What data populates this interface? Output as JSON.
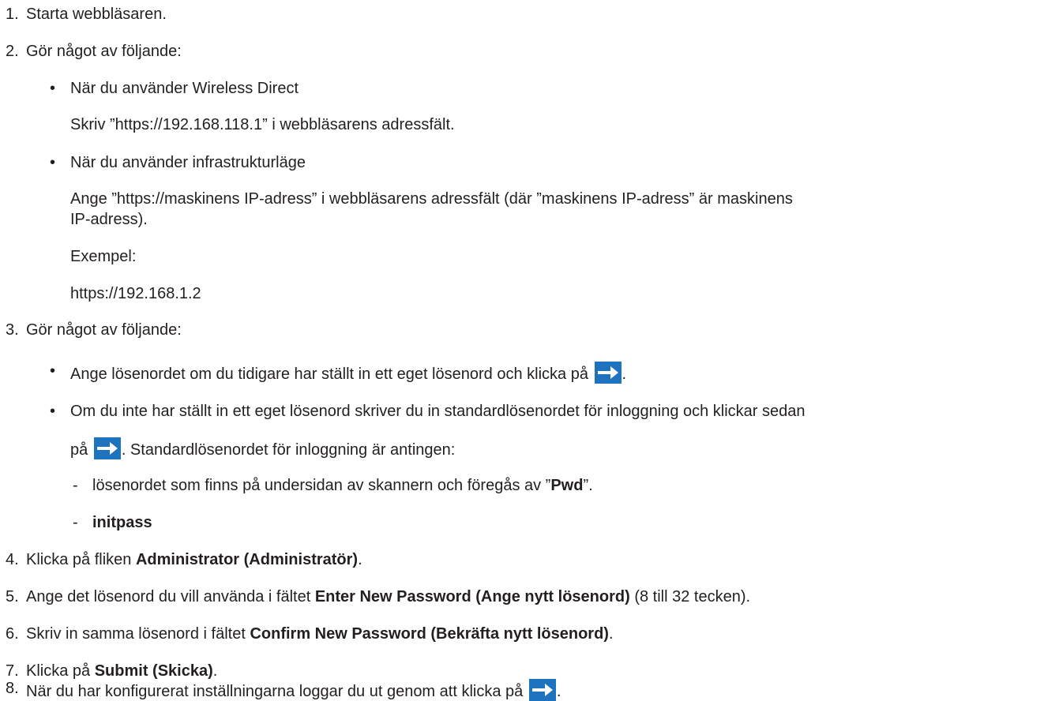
{
  "steps": {
    "s1": {
      "num": "1.",
      "text": "Starta webbläsaren."
    },
    "s2": {
      "num": "2.",
      "text": "Gör något av följande:",
      "b1": {
        "title": "När du använder Wireless Direct",
        "text": "Skriv ”https://192.168.118.1” i webbläsarens adressfält."
      },
      "b2": {
        "title": "När du använder infrastrukturläge",
        "text_line1": "Ange ”https://maskinens IP-adress” i webbläsarens adressfält (där ”maskinens IP-adress” är maskinens",
        "text_line2": "IP-adress).",
        "example_label": "Exempel:",
        "example_value": "https://192.168.1.2"
      }
    },
    "s3": {
      "num": "3.",
      "text": "Gör något av följande:",
      "b1": {
        "text": "Ange lösenordet om du tidigare har ställt in ett eget lösenord och klicka på ",
        "end": "."
      },
      "b2": {
        "line1": "Om du inte har ställt in ett eget lösenord skriver du in standardlösenordet för inloggning och klickar sedan",
        "line2_pre": "på ",
        "line2_post": ". Standardlösenordet för inloggning är antingen:",
        "d1_pre": "lösenordet som finns på undersidan av skannern och föregås av ”",
        "d1_bold": "Pwd",
        "d1_post": "”.",
        "d2_bold": "initpass"
      }
    },
    "s4": {
      "num": "4.",
      "pre": "Klicka på fliken ",
      "bold": "Administrator (Administratör)",
      "post": "."
    },
    "s5": {
      "num": "5.",
      "pre": "Ange det lösenord du vill använda i fältet ",
      "bold": "Enter New Password (Ange nytt lösenord)",
      "post": " (8 till 32 tecken)."
    },
    "s6": {
      "num": "6.",
      "pre": "Skriv in samma lösenord i fältet ",
      "bold": "Confirm New Password (Bekräfta nytt lösenord)",
      "post": "."
    },
    "s7": {
      "num": "7.",
      "pre": "Klicka på ",
      "bold": "Submit (Skicka)",
      "post": "."
    },
    "s8": {
      "num": "8.",
      "pre": "När du har konfigurerat inställningarna loggar du ut genom att klicka på ",
      "post": "."
    }
  },
  "bullet_glyph": "•",
  "dash_glyph": "-",
  "icons": {
    "go": "arrow-right-icon"
  },
  "colors": {
    "icon_bg": "#1e73be",
    "icon_arrow": "#ffffff",
    "text": "#231f20"
  }
}
